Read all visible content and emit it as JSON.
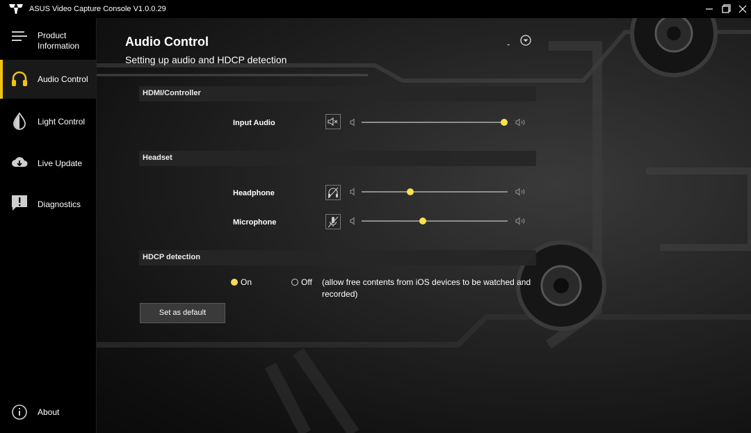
{
  "window": {
    "title": "ASUS Video Capture Console V1.0.0.29"
  },
  "sidebar": {
    "items": [
      {
        "label_line1": "Product",
        "label_line2": "Information",
        "icon": "menu-lines-icon"
      },
      {
        "label": "Audio Control",
        "icon": "headset-icon",
        "active": true
      },
      {
        "label": "Light Control",
        "icon": "light-drop-icon"
      },
      {
        "label": "Live Update",
        "icon": "cloud-download-icon"
      },
      {
        "label": "Diagnostics",
        "icon": "alert-bubble-icon"
      }
    ],
    "about": {
      "label": "About",
      "icon": "info-icon"
    }
  },
  "page": {
    "title": "Audio Control",
    "subtitle": "Setting up audio and HDCP detection",
    "collapse_dash": "-"
  },
  "hdmi": {
    "section": "HDMI/Controller",
    "input_audio": {
      "label": "Input Audio",
      "level": 1.0
    }
  },
  "headset": {
    "section": "Headset",
    "headphone": {
      "label": "Headphone",
      "level": 0.34
    },
    "microphone": {
      "label": "Microphone",
      "level": 0.43
    }
  },
  "hdcp": {
    "section": "HDCP detection",
    "on_label": "On",
    "off_label": "Off",
    "selected": "On",
    "note": "(allow free contents from iOS devices to be watched and recorded)"
  },
  "actions": {
    "set_default": "Set as default"
  },
  "colors": {
    "accent": "#f2c313",
    "slider_thumb": "#f8e24b"
  }
}
